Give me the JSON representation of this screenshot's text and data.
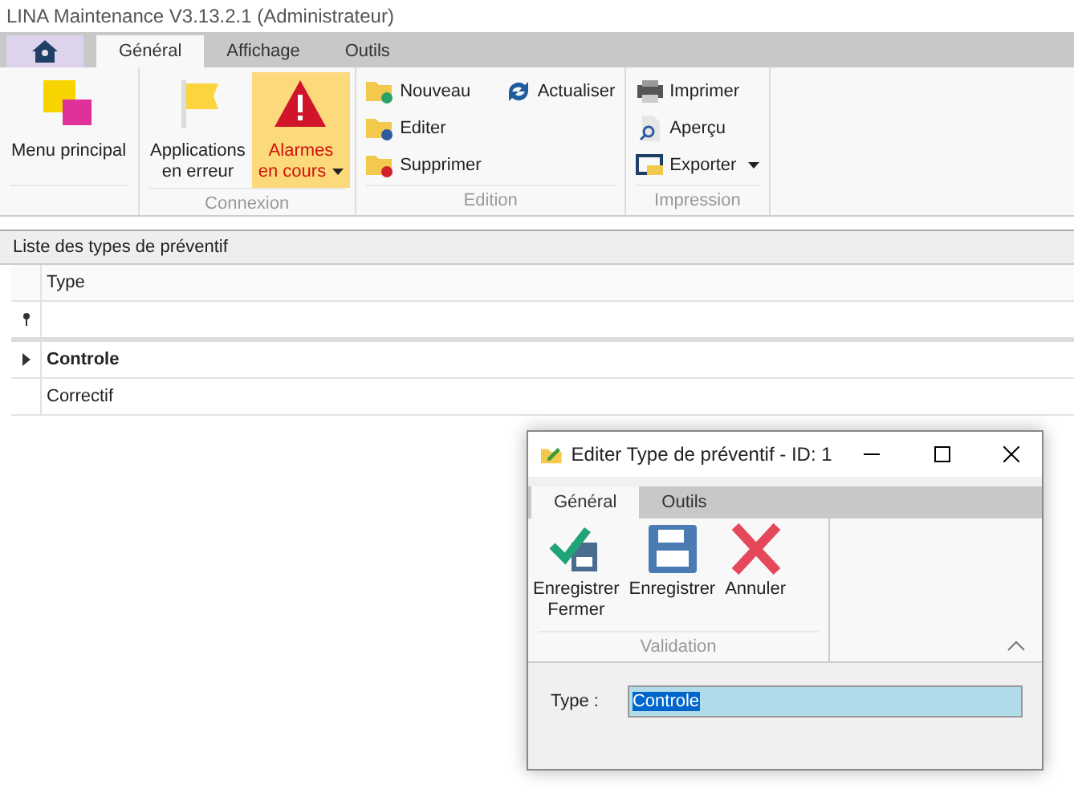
{
  "window": {
    "title": "LINA Maintenance  V3.13.2.1  (Administrateur)"
  },
  "tabs": [
    {
      "label": "Général",
      "selected": true
    },
    {
      "label": "Affichage",
      "selected": false
    },
    {
      "label": "Outils",
      "selected": false
    }
  ],
  "ribbon_groups": [
    {
      "items": [
        {
          "kind": "logo",
          "label": "Menu principal",
          "selected": false
        }
      ]
    },
    {
      "label": "Connexion",
      "items": [
        {
          "kind": "flag",
          "label": "Applications\nen erreur",
          "selected": false
        },
        {
          "kind": "alarm",
          "label": "Alarmes\nen cours",
          "dropdown": true,
          "selected": true
        }
      ]
    },
    {
      "label": "Edition",
      "items": [
        {
          "kind": "new",
          "label": "Nouveau"
        },
        {
          "kind": "edit",
          "label": "Editer"
        },
        {
          "kind": "delete",
          "label": "Supprimer"
        },
        {
          "kind": "refresh",
          "label": "Actualiser"
        }
      ]
    },
    {
      "label": "Impression",
      "items": [
        {
          "kind": "print",
          "label": "Imprimer"
        },
        {
          "kind": "preview",
          "label": "Aperçu"
        },
        {
          "kind": "export",
          "label": "Exporter",
          "dropdown": true
        }
      ]
    }
  ],
  "panel": {
    "title": "Liste des types de préventif"
  },
  "table": {
    "columns": [
      "Type"
    ],
    "rows": [
      {
        "type": "Controle",
        "selected": true
      },
      {
        "type": "Correctif",
        "selected": false
      }
    ]
  },
  "dialog": {
    "title": "Editer Type de préventif - ID: 1",
    "tabs": [
      {
        "label": "Général",
        "selected": true
      },
      {
        "label": "Outils",
        "selected": false
      }
    ],
    "group": {
      "label": "Validation",
      "buttons": [
        {
          "kind": "save-close",
          "label": "Enregistrer\nFermer"
        },
        {
          "kind": "save",
          "label": "Enregistrer"
        },
        {
          "kind": "cancel",
          "label": "Annuler"
        }
      ]
    },
    "field": {
      "label": "Type :",
      "value": "Controle"
    }
  }
}
